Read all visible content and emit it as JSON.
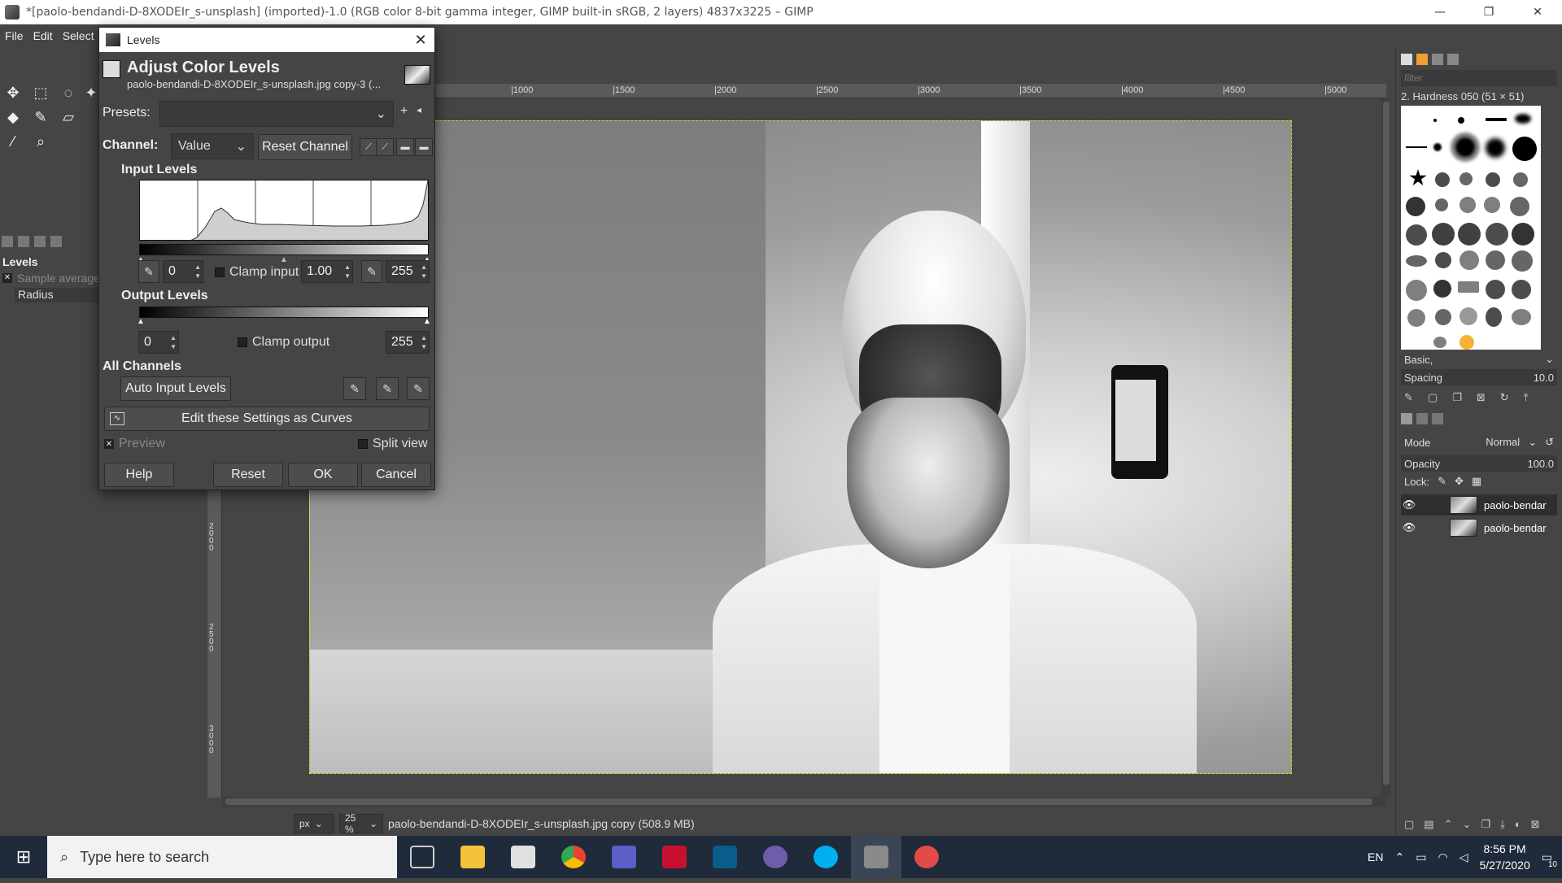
{
  "window": {
    "title": "*[paolo-bendandi-D-8XODEIr_s-unsplash] (imported)-1.0 (RGB color 8-bit gamma integer, GIMP built-in sRGB, 2 layers) 4837x3225 – GIMP",
    "minimize": "—",
    "maximize": "❐",
    "close": "✕"
  },
  "menu": [
    "File",
    "Edit",
    "Select"
  ],
  "tool_options": {
    "title": "Levels",
    "sample_average": "Sample average",
    "radius_label": "Radius"
  },
  "ruler": {
    "top": [
      "|1000",
      "|1500",
      "|2000",
      "|2500",
      "|3000",
      "|3500",
      "|4000",
      "|4500",
      "|5000"
    ],
    "left": [
      "2000",
      "2500",
      "3000"
    ]
  },
  "status": {
    "unit": "px",
    "zoom": "25 %",
    "info": "paolo-bendandi-D-8XODEIr_s-unsplash.jpg copy (508.9 MB)"
  },
  "dock": {
    "filter_placeholder": "filter",
    "brush_name": "2. Hardness 050 (51 × 51)",
    "preset": "Basic,",
    "spacing_label": "Spacing",
    "spacing_value": "10.0",
    "mode_label": "Mode",
    "mode_value": "Normal",
    "opacity_label": "Opacity",
    "opacity_value": "100.0",
    "lock_label": "Lock:",
    "layers": [
      {
        "name": "paolo-bendar"
      },
      {
        "name": "paolo-bendar"
      }
    ]
  },
  "levels": {
    "dialog_title": "Levels",
    "header_title": "Adjust Color Levels",
    "header_sub": "paolo-bendandi-D-8XODEIr_s-unsplash.jpg copy-3 (...",
    "presets_label": "Presets:",
    "channel_label": "Channel:",
    "channel_value": "Value",
    "reset_channel": "Reset Channel",
    "input_levels": "Input Levels",
    "input_low": "0",
    "clamp_input": "Clamp input",
    "gamma": "1.00",
    "input_high": "255",
    "output_levels": "Output Levels",
    "output_low": "0",
    "clamp_output": "Clamp output",
    "output_high": "255",
    "all_channels": "All Channels",
    "auto_input": "Auto Input Levels",
    "edit_curves": "Edit these Settings as Curves",
    "preview": "Preview",
    "split_view": "Split view",
    "help": "Help",
    "reset": "Reset",
    "ok": "OK",
    "cancel": "Cancel"
  },
  "taskbar": {
    "search_placeholder": "Type here to search",
    "lang": "EN",
    "time": "8:56 PM",
    "date": "5/27/2020",
    "notifications": "10"
  }
}
